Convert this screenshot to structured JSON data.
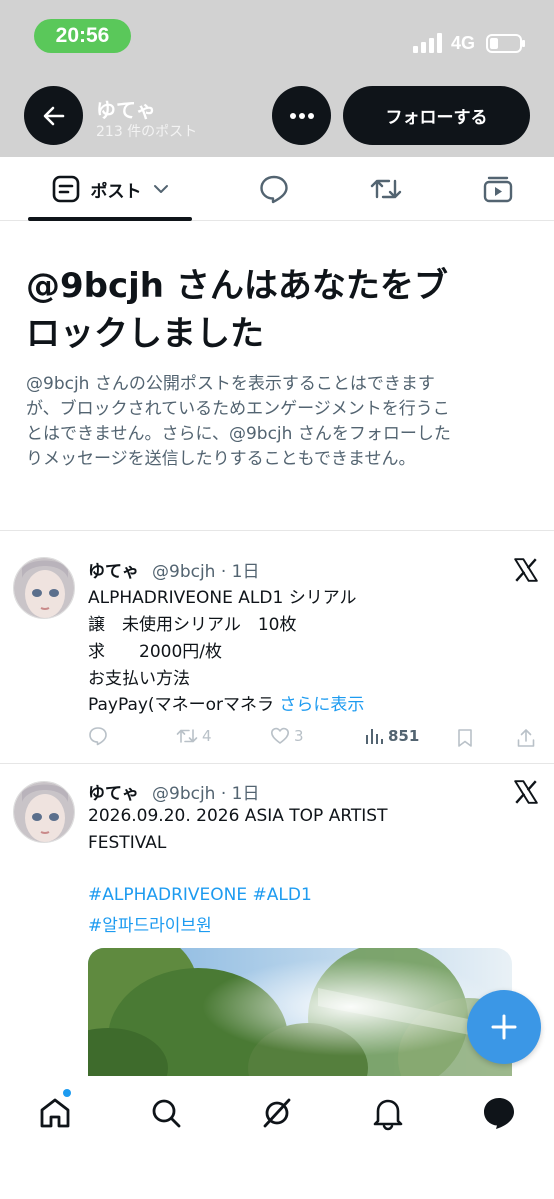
{
  "status_bar": {
    "time": "20:56",
    "network": "4G",
    "icons": [
      "signal-icon",
      "battery-icon"
    ]
  },
  "header": {
    "name": "ゆてゃ",
    "post_count": "213 件のポスト",
    "follow_label": "フォローする",
    "icons": [
      "back-arrow-icon",
      "more-icon"
    ]
  },
  "tabs": {
    "active_label": "ポスト",
    "icons": [
      "post-icon",
      "chevron-down-icon",
      "reply-icon",
      "repost-icon",
      "media-icon"
    ]
  },
  "block_notice": {
    "title_line1": "@9bcjh さんはあなたをブ",
    "title_line2": "ロックしました",
    "desc_line1": "@9bcjh さんの公開ポストを表示することはできます",
    "desc_line2": "が、ブロックされているためエンゲージメントを行うこ",
    "desc_line3": "とはできません。さらに、@9bcjh さんをフォローした",
    "desc_line4": "りメッセージを送信したりすることもできません。"
  },
  "posts": [
    {
      "name": "ゆてゃ",
      "meta": "@9bcjh · 1日",
      "lines": [
        "ALPHADRIVEONE ALD1 シリアル",
        "譲　未使用シリアル　10枚",
        "求　　2000円/枚",
        "お支払い方法",
        "PayPay(マネーorマネラ "
      ],
      "show_more": "さらに表示",
      "reposts": "4",
      "likes": "3",
      "views": "851"
    },
    {
      "name": "ゆてゃ",
      "meta": "@9bcjh · 1日",
      "lines": [
        "2026.09.20. 2026 ASIA TOP ARTIST",
        "FESTIVAL"
      ],
      "hashtags_line1": "#ALPHADRIVEONE #ALD1",
      "hashtags_line2": "#알파드라이브원"
    }
  ],
  "colors": {
    "accent": "#1d9bf0",
    "header_bg": "#d2d2d2",
    "status_pill": "#5ac85a",
    "fab": "#3b97e6"
  },
  "bottom_nav": {
    "icons": [
      "home-icon",
      "search-icon",
      "grok-icon",
      "notifications-icon",
      "messages-icon"
    ]
  }
}
